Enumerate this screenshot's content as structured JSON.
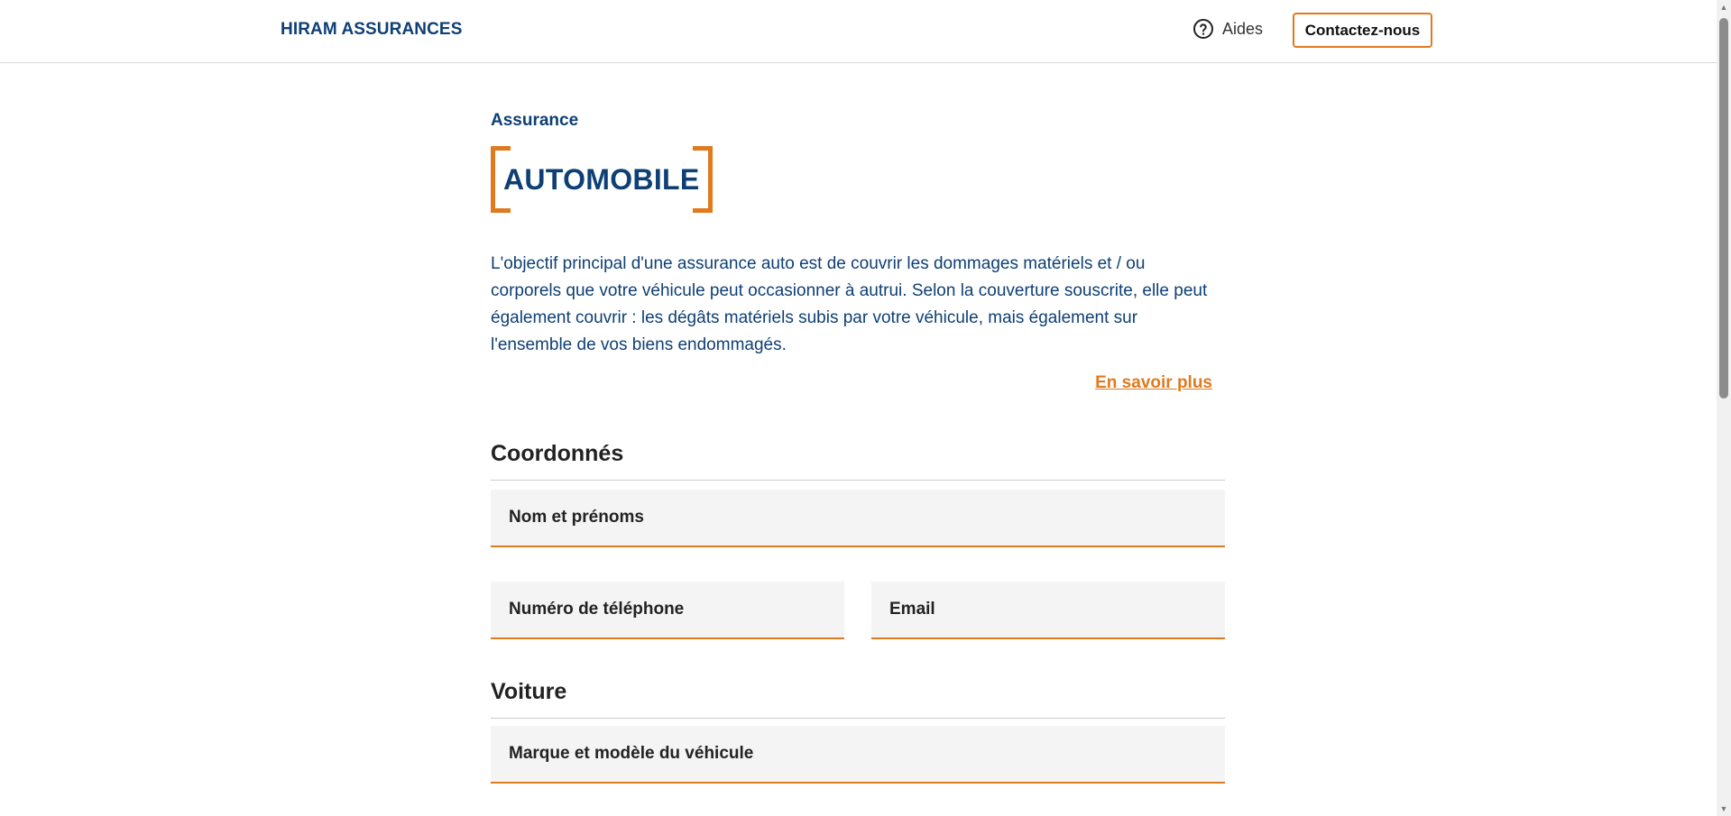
{
  "header": {
    "brand": "HIRAM ASSURANCES",
    "help_label": "Aides",
    "help_icon": "help-circle-icon",
    "contact_label": "Contactez-nous"
  },
  "hero": {
    "kicker": "Assurance",
    "title": "AUTOMOBILE",
    "intro": "L'objectif principal d'une assurance auto est de couvrir les dommages matériels et / ou corporels que votre véhicule peut occasionner à autrui. Selon la couverture souscrite, elle peut également couvrir : les dégâts matériels subis par votre véhicule, mais également sur l'ensemble de vos biens endommagés.",
    "more_link": "En savoir plus"
  },
  "sections": {
    "contact": {
      "title": "Coordonnés",
      "fields": {
        "full_name": {
          "placeholder": "Nom et prénoms",
          "value": ""
        },
        "phone": {
          "placeholder": "Numéro de téléphone",
          "value": ""
        },
        "email": {
          "placeholder": "Email",
          "value": ""
        }
      }
    },
    "car": {
      "title": "Voiture",
      "fields": {
        "make_model": {
          "placeholder": "Marque et modèle du véhicule",
          "value": ""
        }
      }
    }
  },
  "colors": {
    "brand_blue": "#0e3f75",
    "accent_orange": "#e07a1f",
    "field_bg": "#f4f4f4"
  }
}
